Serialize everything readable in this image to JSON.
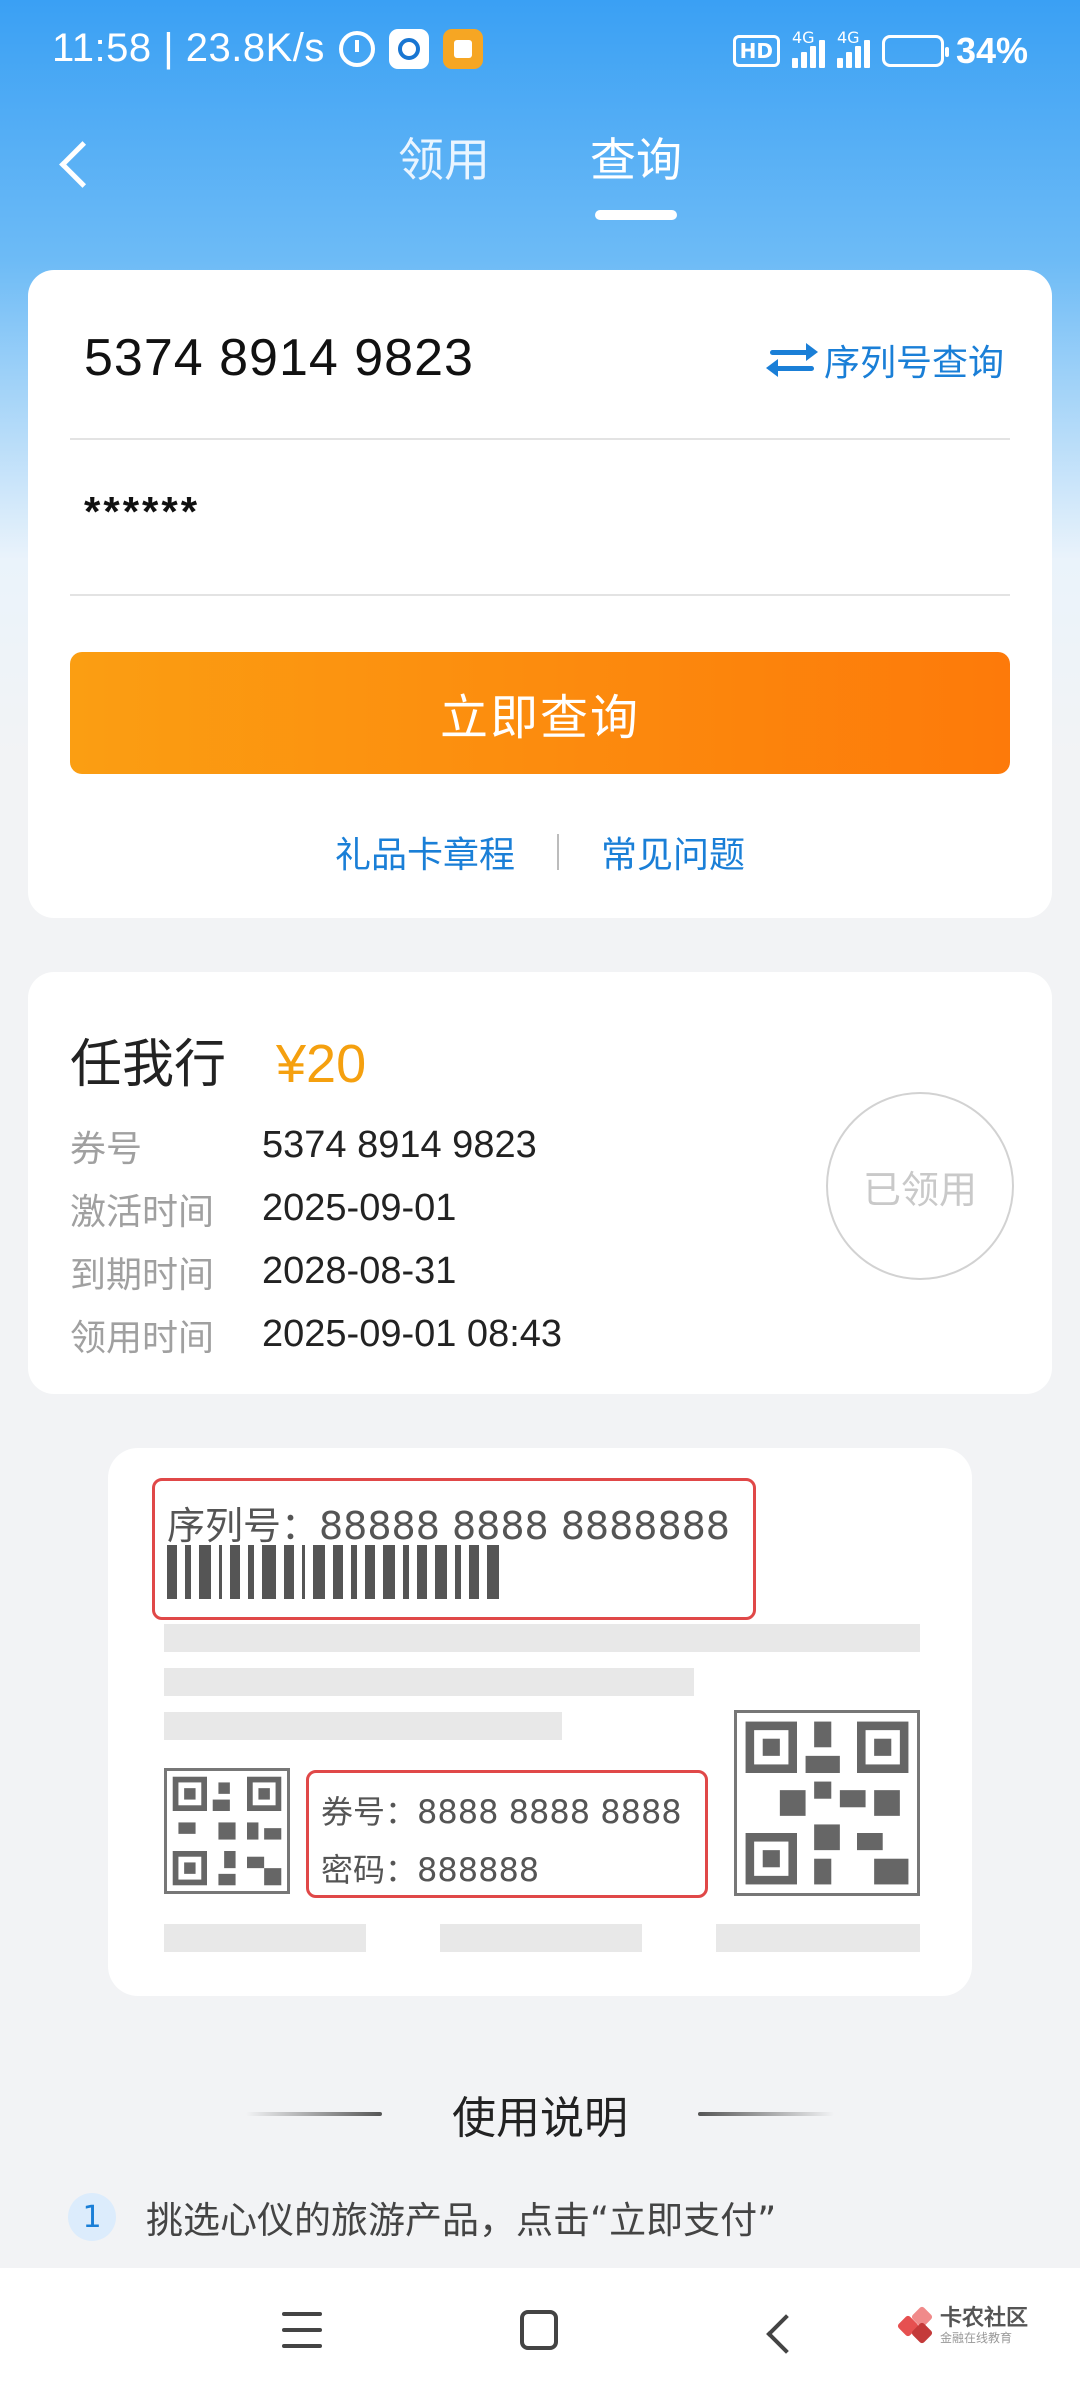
{
  "status_bar": {
    "time_speed": "11:58 | 23.8K/s",
    "hd_label": "HD",
    "network_1": "4G",
    "network_2": "4G",
    "battery_percent": "34%",
    "battery_level": 0.34
  },
  "header": {
    "tabs": [
      {
        "label": "领用",
        "active": false
      },
      {
        "label": "查询",
        "active": true
      }
    ]
  },
  "query_form": {
    "card_number": "5374 8914 9823",
    "serial_query_label": "序列号查询",
    "password_masked": "******",
    "submit_label": "立即查询",
    "links": [
      "礼品卡章程",
      "常见问题"
    ]
  },
  "result": {
    "name": "任我行",
    "amount": "¥20",
    "rows": [
      {
        "label": "券号",
        "value": "5374 8914 9823"
      },
      {
        "label": "激活时间",
        "value": "2025-09-01"
      },
      {
        "label": "到期时间",
        "value": "2028-08-31"
      },
      {
        "label": "领用时间",
        "value": "2025-09-01 08:43"
      }
    ],
    "status_stamp": "已领用"
  },
  "illustration": {
    "serial_text": "序列号：88888 8888 8888888",
    "coupon_text": "券号：8888 8888 8888",
    "password_text": "密码：888888"
  },
  "usage": {
    "title": "使用说明",
    "steps": [
      {
        "num": "1",
        "text": "挑选心仪的旅游产品，点击“立即支付”"
      }
    ]
  },
  "watermark": {
    "main": "卡农社区",
    "sub": "金融在线教育"
  },
  "colors": {
    "brand_blue": "#1a7fd7",
    "button_orange": "#fd7a0a",
    "amount_orange": "#f5a00f",
    "highlight_red": "#e04848"
  }
}
